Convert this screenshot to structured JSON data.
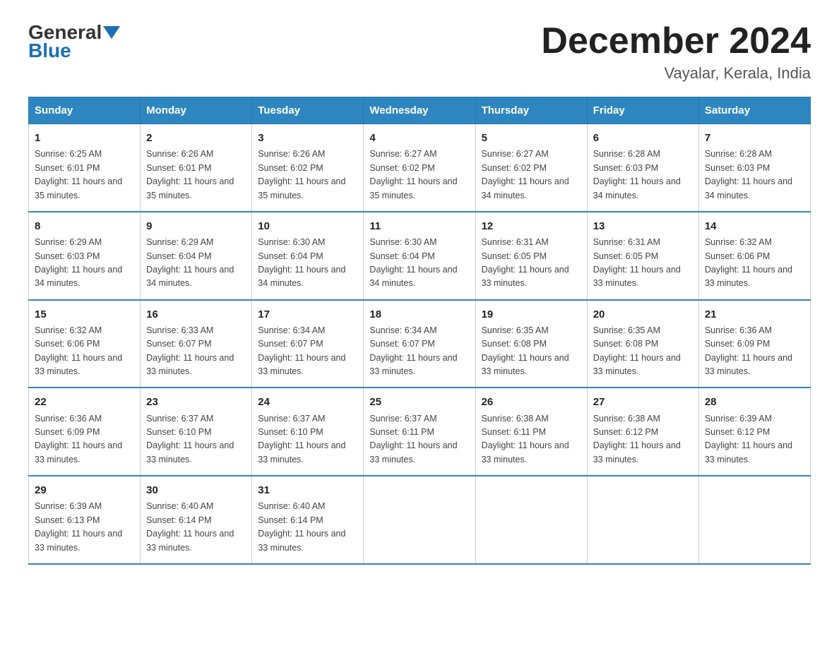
{
  "header": {
    "logo": {
      "general": "General",
      "blue": "Blue"
    },
    "title": "December 2024",
    "location": "Vayalar, Kerala, India"
  },
  "days_of_week": [
    "Sunday",
    "Monday",
    "Tuesday",
    "Wednesday",
    "Thursday",
    "Friday",
    "Saturday"
  ],
  "weeks": [
    [
      {
        "num": "1",
        "sunrise": "6:25 AM",
        "sunset": "6:01 PM",
        "daylight": "11 hours and 35 minutes."
      },
      {
        "num": "2",
        "sunrise": "6:26 AM",
        "sunset": "6:01 PM",
        "daylight": "11 hours and 35 minutes."
      },
      {
        "num": "3",
        "sunrise": "6:26 AM",
        "sunset": "6:02 PM",
        "daylight": "11 hours and 35 minutes."
      },
      {
        "num": "4",
        "sunrise": "6:27 AM",
        "sunset": "6:02 PM",
        "daylight": "11 hours and 35 minutes."
      },
      {
        "num": "5",
        "sunrise": "6:27 AM",
        "sunset": "6:02 PM",
        "daylight": "11 hours and 34 minutes."
      },
      {
        "num": "6",
        "sunrise": "6:28 AM",
        "sunset": "6:03 PM",
        "daylight": "11 hours and 34 minutes."
      },
      {
        "num": "7",
        "sunrise": "6:28 AM",
        "sunset": "6:03 PM",
        "daylight": "11 hours and 34 minutes."
      }
    ],
    [
      {
        "num": "8",
        "sunrise": "6:29 AM",
        "sunset": "6:03 PM",
        "daylight": "11 hours and 34 minutes."
      },
      {
        "num": "9",
        "sunrise": "6:29 AM",
        "sunset": "6:04 PM",
        "daylight": "11 hours and 34 minutes."
      },
      {
        "num": "10",
        "sunrise": "6:30 AM",
        "sunset": "6:04 PM",
        "daylight": "11 hours and 34 minutes."
      },
      {
        "num": "11",
        "sunrise": "6:30 AM",
        "sunset": "6:04 PM",
        "daylight": "11 hours and 34 minutes."
      },
      {
        "num": "12",
        "sunrise": "6:31 AM",
        "sunset": "6:05 PM",
        "daylight": "11 hours and 33 minutes."
      },
      {
        "num": "13",
        "sunrise": "6:31 AM",
        "sunset": "6:05 PM",
        "daylight": "11 hours and 33 minutes."
      },
      {
        "num": "14",
        "sunrise": "6:32 AM",
        "sunset": "6:06 PM",
        "daylight": "11 hours and 33 minutes."
      }
    ],
    [
      {
        "num": "15",
        "sunrise": "6:32 AM",
        "sunset": "6:06 PM",
        "daylight": "11 hours and 33 minutes."
      },
      {
        "num": "16",
        "sunrise": "6:33 AM",
        "sunset": "6:07 PM",
        "daylight": "11 hours and 33 minutes."
      },
      {
        "num": "17",
        "sunrise": "6:34 AM",
        "sunset": "6:07 PM",
        "daylight": "11 hours and 33 minutes."
      },
      {
        "num": "18",
        "sunrise": "6:34 AM",
        "sunset": "6:07 PM",
        "daylight": "11 hours and 33 minutes."
      },
      {
        "num": "19",
        "sunrise": "6:35 AM",
        "sunset": "6:08 PM",
        "daylight": "11 hours and 33 minutes."
      },
      {
        "num": "20",
        "sunrise": "6:35 AM",
        "sunset": "6:08 PM",
        "daylight": "11 hours and 33 minutes."
      },
      {
        "num": "21",
        "sunrise": "6:36 AM",
        "sunset": "6:09 PM",
        "daylight": "11 hours and 33 minutes."
      }
    ],
    [
      {
        "num": "22",
        "sunrise": "6:36 AM",
        "sunset": "6:09 PM",
        "daylight": "11 hours and 33 minutes."
      },
      {
        "num": "23",
        "sunrise": "6:37 AM",
        "sunset": "6:10 PM",
        "daylight": "11 hours and 33 minutes."
      },
      {
        "num": "24",
        "sunrise": "6:37 AM",
        "sunset": "6:10 PM",
        "daylight": "11 hours and 33 minutes."
      },
      {
        "num": "25",
        "sunrise": "6:37 AM",
        "sunset": "6:11 PM",
        "daylight": "11 hours and 33 minutes."
      },
      {
        "num": "26",
        "sunrise": "6:38 AM",
        "sunset": "6:11 PM",
        "daylight": "11 hours and 33 minutes."
      },
      {
        "num": "27",
        "sunrise": "6:38 AM",
        "sunset": "6:12 PM",
        "daylight": "11 hours and 33 minutes."
      },
      {
        "num": "28",
        "sunrise": "6:39 AM",
        "sunset": "6:12 PM",
        "daylight": "11 hours and 33 minutes."
      }
    ],
    [
      {
        "num": "29",
        "sunrise": "6:39 AM",
        "sunset": "6:13 PM",
        "daylight": "11 hours and 33 minutes."
      },
      {
        "num": "30",
        "sunrise": "6:40 AM",
        "sunset": "6:14 PM",
        "daylight": "11 hours and 33 minutes."
      },
      {
        "num": "31",
        "sunrise": "6:40 AM",
        "sunset": "6:14 PM",
        "daylight": "11 hours and 33 minutes."
      },
      null,
      null,
      null,
      null
    ]
  ]
}
